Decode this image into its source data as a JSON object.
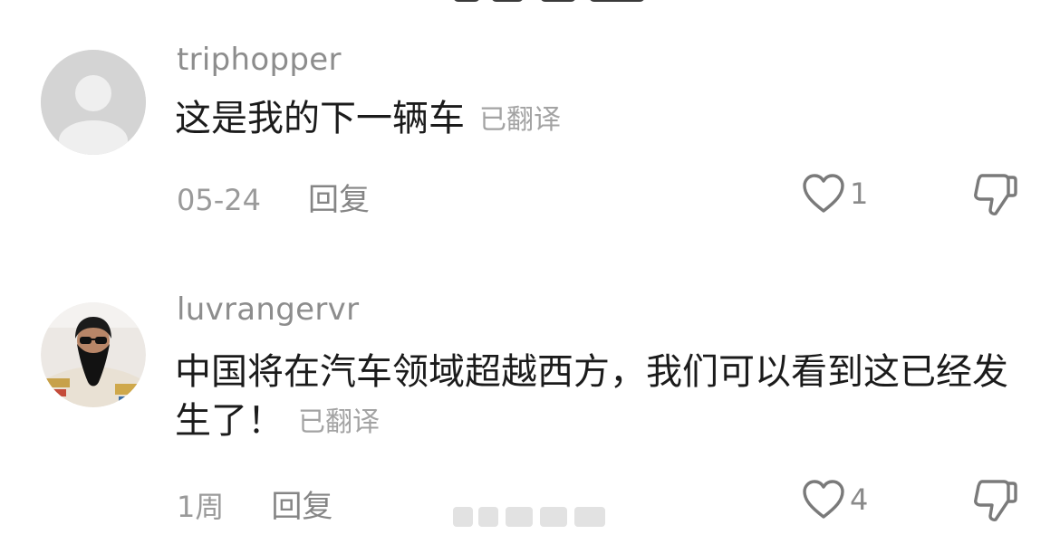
{
  "comments": [
    {
      "username": "triphopper",
      "text": "这是我的下一辆车",
      "translated_label": "已翻译",
      "date": "05-24",
      "reply_label": "回复",
      "likes": "1",
      "avatar": "default-avatar"
    },
    {
      "username": "luvrangervr",
      "text": "中国将在汽车领域超越西方，我们可以看到这已经发生了！",
      "translated_label": "已翻译",
      "date": "1周",
      "reply_label": "回复",
      "likes": "4",
      "avatar": "user-photo-avatar"
    }
  ],
  "icons": {
    "like": "heart-outline-icon",
    "dislike": "thumbs-down-icon"
  },
  "colors": {
    "username": "#8d8d8d",
    "text": "#1b1b1b",
    "meta": "#9a9a9a",
    "icon": "#7a7a7a"
  }
}
